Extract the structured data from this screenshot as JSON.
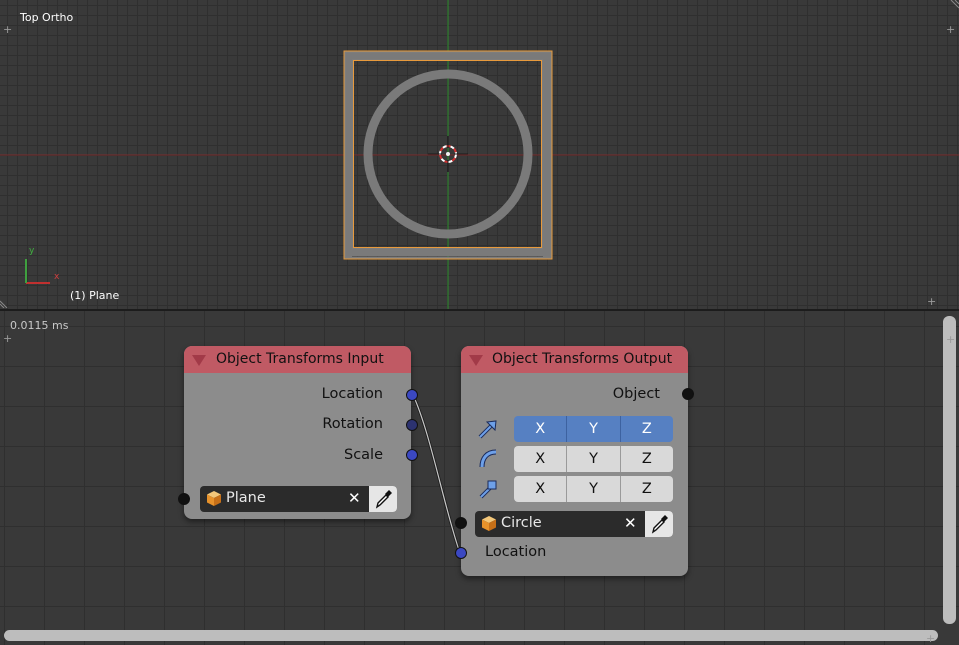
{
  "viewport": {
    "view_name": "Top Ortho",
    "active_object_label": "(1) Plane",
    "axis_x": "x",
    "axis_y": "y",
    "accent_select": "#e89a3c",
    "x_axis_color": "#8a2a2a",
    "y_axis_color": "#2f8a2f",
    "corner_glyph": "+"
  },
  "node_editor": {
    "timing": "0.0115 ms",
    "header_color": "#c05a64",
    "socket_color": "#3b48c2",
    "nodes": [
      {
        "title": "Object Transforms Input",
        "outputs": [
          "Location",
          "Rotation",
          "Scale"
        ],
        "object_field": {
          "value": "Plane",
          "clear_icon": "x-icon",
          "picker_icon": "eyedropper-icon"
        }
      },
      {
        "title": "Object Transforms Output",
        "outputs": [
          "Object"
        ],
        "toggles": [
          {
            "icon": "location-arrow-icon",
            "axes": [
              "X",
              "Y",
              "Z"
            ],
            "active": true
          },
          {
            "icon": "rotation-arc-icon",
            "axes": [
              "X",
              "Y",
              "Z"
            ],
            "active": false
          },
          {
            "icon": "scale-icon",
            "axes": [
              "X",
              "Y",
              "Z"
            ],
            "active": false
          }
        ],
        "object_field": {
          "value": "Circle",
          "clear_icon": "x-icon",
          "picker_icon": "eyedropper-icon"
        },
        "inputs": [
          "Location"
        ]
      }
    ]
  }
}
